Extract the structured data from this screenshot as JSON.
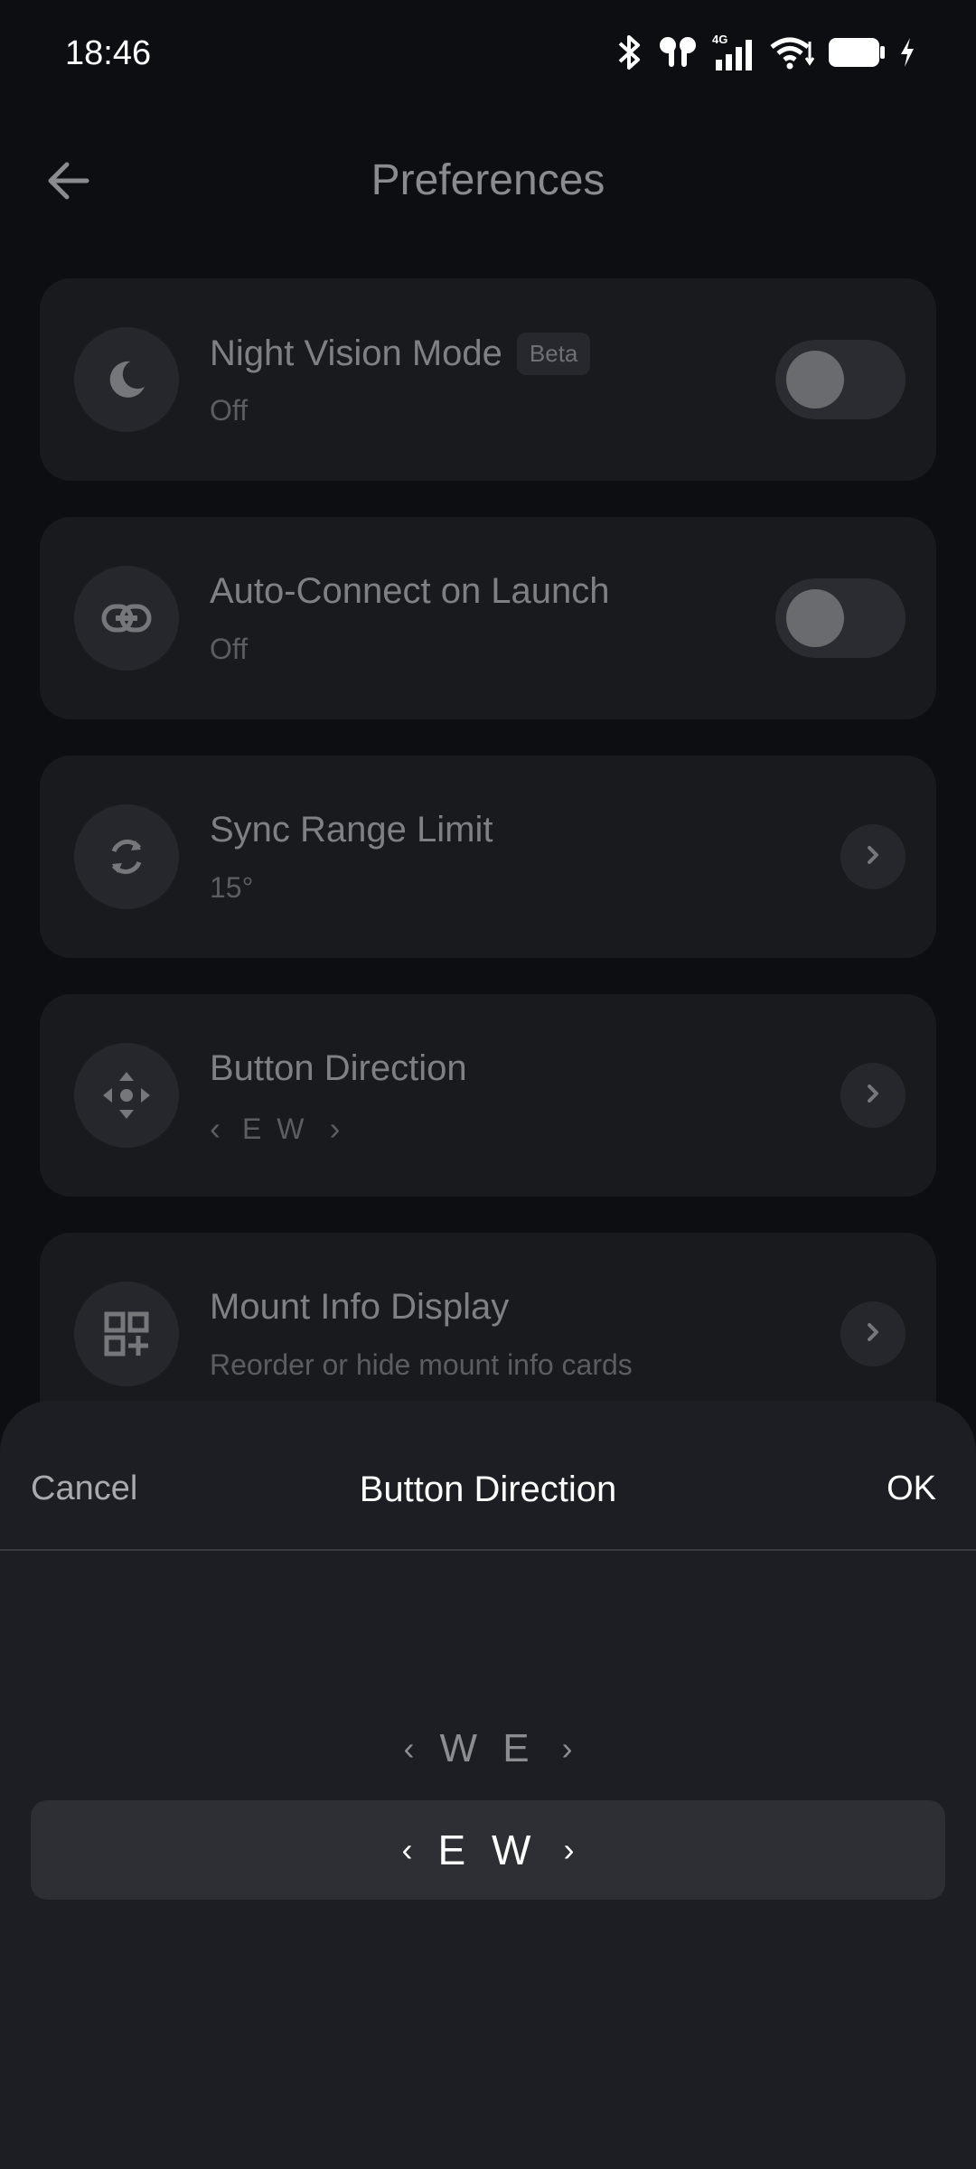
{
  "status_bar": {
    "time": "18:46",
    "icons": [
      "bluetooth-icon",
      "earbuds-icon",
      "signal-4g-icon",
      "wifi-icon",
      "battery-icon",
      "charging-icon"
    ]
  },
  "header": {
    "title": "Preferences",
    "back_icon": "arrow-left-icon"
  },
  "settings": [
    {
      "title": "Night Vision Mode",
      "badge": "Beta",
      "subtitle": "Off",
      "icon": "moon-icon",
      "control": "toggle",
      "on": false
    },
    {
      "title": "Auto-Connect on Launch",
      "subtitle": "Off",
      "icon": "link-icon",
      "control": "toggle",
      "on": false
    },
    {
      "title": "Sync Range Limit",
      "subtitle": "15°",
      "icon": "sync-icon",
      "control": "chevron"
    },
    {
      "title": "Button Direction",
      "subtitle_left": "‹",
      "subtitle": "E W",
      "subtitle_right": "›",
      "icon": "direction-pad-icon",
      "control": "chevron"
    },
    {
      "title": "Mount Info Display",
      "subtitle": "Reorder or hide mount info cards",
      "icon": "dashboard-add-icon",
      "control": "chevron"
    }
  ],
  "sheet": {
    "cancel_label": "Cancel",
    "title": "Button Direction",
    "ok_label": "OK",
    "options": [
      {
        "left": "‹",
        "label": "W E",
        "right": "›",
        "selected": false
      },
      {
        "left": "‹",
        "label": "E W",
        "right": "›",
        "selected": true
      }
    ]
  },
  "colors": {
    "background": "#0d0e11",
    "card": "#191a1e",
    "sheet": "#1d1e23",
    "selected_row": "#2d2f34"
  }
}
